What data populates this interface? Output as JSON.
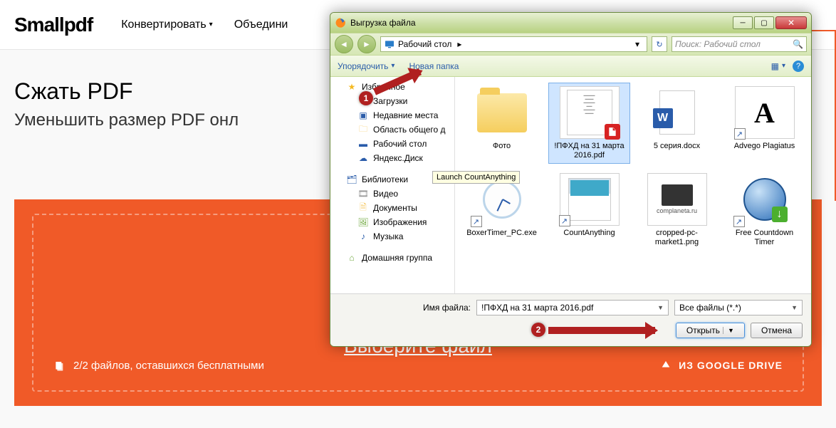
{
  "page": {
    "logo": "Smallpdf",
    "nav": {
      "convert": "Конвертировать",
      "merge": "Объедини"
    },
    "title": "Сжать PDF",
    "subtitle": "Уменьшить размер PDF онл",
    "choose_file": "Выберите файл",
    "files_remaining": "2/2 файлов, оставшихся бесплатными",
    "gdrive": "ИЗ GOOGLE DRIVE"
  },
  "dialog": {
    "title": "Выгрузка файла",
    "path": "Рабочий стол",
    "search_placeholder": "Поиск: Рабочий стол",
    "toolbar": {
      "organize": "Упорядочить",
      "new_folder": "Новая папка"
    },
    "sidebar": {
      "favorites": "Избранное",
      "fav_items": [
        "Загрузки",
        "Недавние места",
        "Область общего д",
        "Рабочий стол",
        "Яндекс.Диск"
      ],
      "libraries": "Библиотеки",
      "lib_items": [
        "Видео",
        "Документы",
        "Изображения",
        "Музыка"
      ],
      "homegroup": "Домашняя группа"
    },
    "files": [
      {
        "label": "Фото",
        "kind": "folder"
      },
      {
        "label": "!ПФХД на 31 марта 2016.pdf",
        "kind": "pdf",
        "selected": true
      },
      {
        "label": "5 серия.docx",
        "kind": "word"
      },
      {
        "label": "Advego Plagiatus",
        "kind": "letterA",
        "shortcut": true
      },
      {
        "label": "BoxerTimer_PC.exe",
        "kind": "clock",
        "shortcut": true
      },
      {
        "label": "CountAnything",
        "kind": "calc",
        "shortcut": true
      },
      {
        "label": "cropped-pc-market1.png",
        "kind": "text",
        "text": "complaneta.ru"
      },
      {
        "label": "Free Countdown Timer",
        "kind": "clockblue",
        "shortcut": true
      }
    ],
    "tooltip": "Launch CountAnything",
    "footer": {
      "filename_label": "Имя файла:",
      "filename_value": "!ПФХД на 31 марта 2016.pdf",
      "filter": "Все файлы (*.*)",
      "open": "Открыть",
      "cancel": "Отмена"
    },
    "callouts": {
      "c1": "1",
      "c2": "2"
    }
  }
}
